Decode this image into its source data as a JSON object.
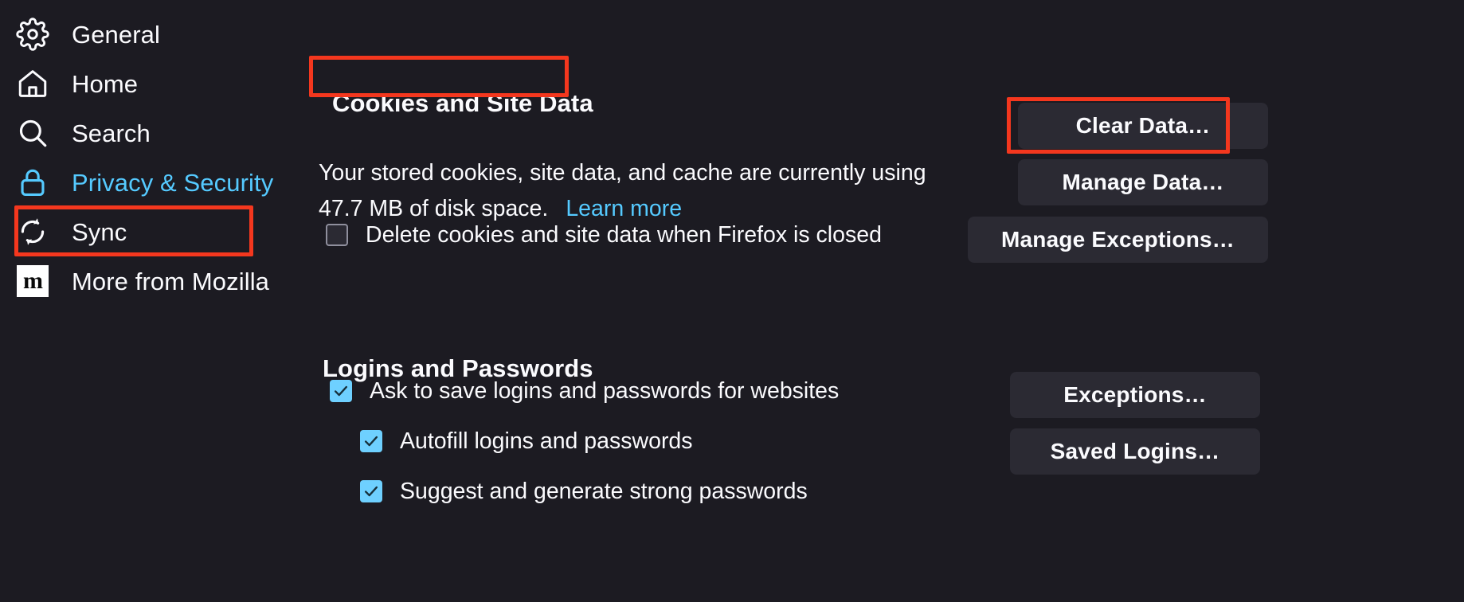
{
  "sidebar": {
    "items": [
      {
        "label": "General",
        "icon": "gear-icon",
        "selected": false
      },
      {
        "label": "Home",
        "icon": "home-icon",
        "selected": false
      },
      {
        "label": "Search",
        "icon": "search-icon",
        "selected": false
      },
      {
        "label": "Privacy & Security",
        "icon": "lock-icon",
        "selected": true
      },
      {
        "label": "Sync",
        "icon": "sync-icon",
        "selected": false
      },
      {
        "label": "More from Mozilla",
        "icon": "mozilla-icon",
        "selected": false
      }
    ],
    "mozilla_mark": "m"
  },
  "cookies_section": {
    "title": "Cookies and Site Data",
    "description": "Your stored cookies, site data, and cache are currently using 47.7 MB of disk space.",
    "learn_more": "Learn more",
    "usage_value": "47.7 MB",
    "checkbox": {
      "label": "Delete cookies and site data when Firefox is closed",
      "checked": false
    },
    "buttons": {
      "clear_data": "Clear Data…",
      "manage_data": "Manage Data…",
      "manage_exceptions": "Manage Exceptions…"
    }
  },
  "logins_section": {
    "title": "Logins and Passwords",
    "checkboxes": [
      {
        "label": "Ask to save logins and passwords for websites",
        "checked": true
      },
      {
        "label": "Autofill logins and passwords",
        "checked": true
      },
      {
        "label": "Suggest and generate strong passwords",
        "checked": true
      }
    ],
    "buttons": {
      "exceptions": "Exceptions…",
      "saved_logins": "Saved Logins…"
    }
  },
  "annotations": {
    "color": "#f4371e",
    "targets": [
      "Privacy & Security",
      "Cookies and Site Data",
      "Clear Data…"
    ]
  },
  "colors": {
    "background": "#1c1b22",
    "button_background": "#2b2a33",
    "accent_blue": "#55caff",
    "checkbox_checked": "#6ed0ff",
    "text": "#fbfbfe",
    "annotation_red": "#f4371e"
  }
}
